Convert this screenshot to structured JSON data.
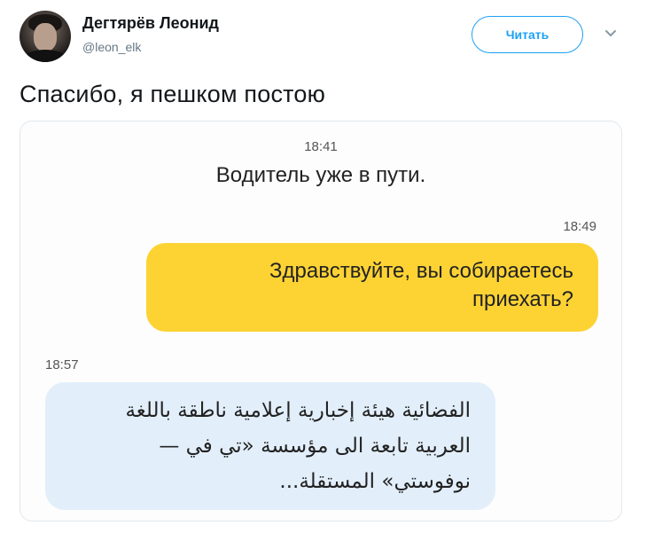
{
  "author": {
    "name": "Дегтярёв Леонид",
    "handle": "@leon_elk"
  },
  "follow_button": {
    "label": "Читать"
  },
  "tweet": {
    "text": "Спасибо, я пешком постою"
  },
  "chat": {
    "status_time": "18:41",
    "status_text": "Водитель уже в пути.",
    "outgoing_time": "18:49",
    "outgoing_text": "Здравствуйте, вы собираетесь приехать?",
    "incoming_time": "18:57",
    "incoming_text": "الفضائية هيئة إخبارية إعلامية ناطقة باللغة العربية تابعة الى مؤسسة «تي في — نوفوستي» المستقلة..."
  },
  "colors": {
    "accent": "#1da1f2",
    "outgoing_bubble": "#fdd334",
    "incoming_bubble": "#e2effa"
  },
  "icons": {
    "menu": "chevron-down-icon"
  }
}
